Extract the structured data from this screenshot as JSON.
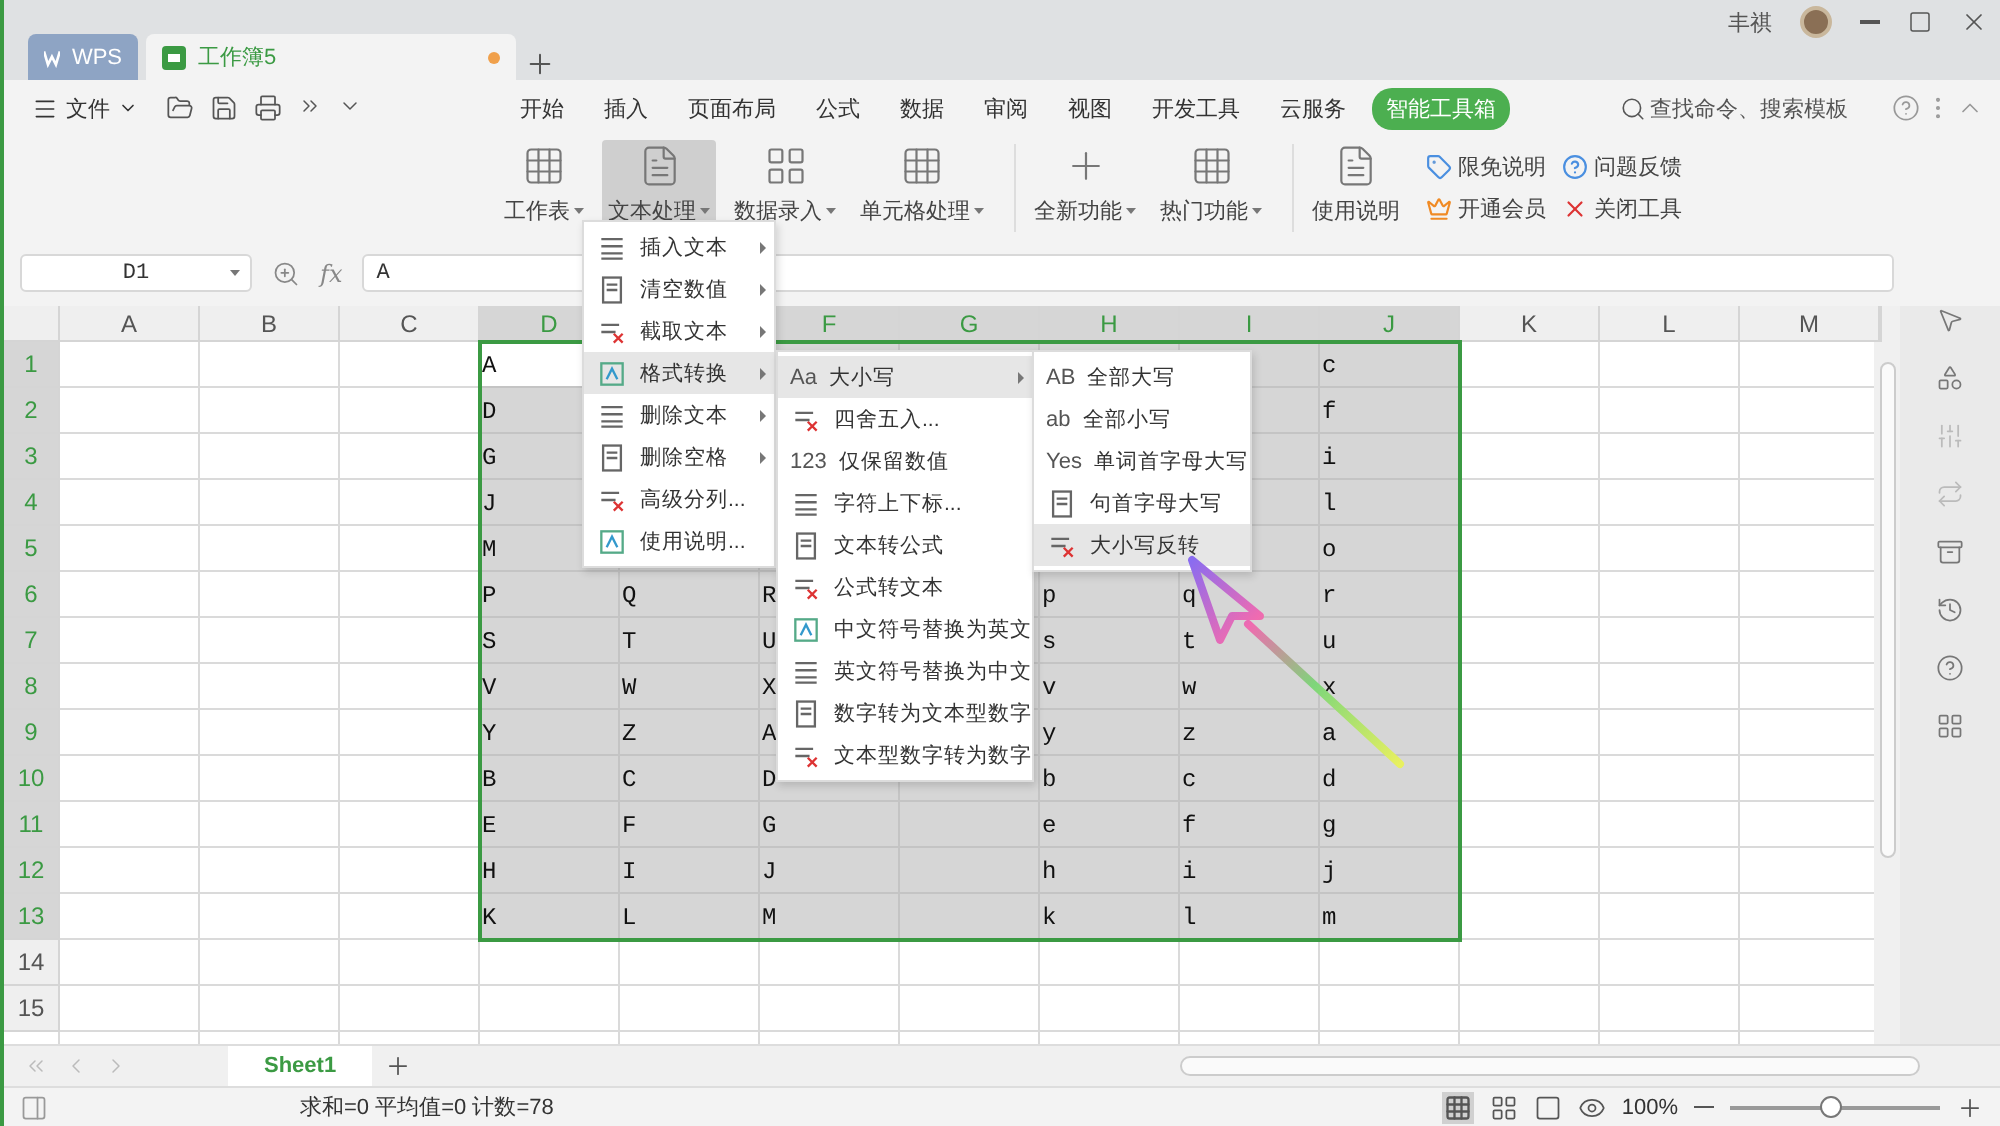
{
  "title_bar": {
    "tabs": [
      {
        "label": "WPS",
        "kind": "home",
        "selected": false
      },
      {
        "label": "工作簿5",
        "kind": "doc",
        "selected": true,
        "unsaved": true
      }
    ],
    "user": "丰祺"
  },
  "quick_bar": {
    "menu": "文件"
  },
  "ribbon_tabs": [
    {
      "label": "开始",
      "selected": false
    },
    {
      "label": "插入",
      "selected": false
    },
    {
      "label": "页面布局",
      "selected": false
    },
    {
      "label": "公式",
      "selected": false
    },
    {
      "label": "数据",
      "selected": false
    },
    {
      "label": "审阅",
      "selected": false
    },
    {
      "label": "视图",
      "selected": false
    },
    {
      "label": "开发工具",
      "selected": false
    },
    {
      "label": "云服务",
      "selected": false
    },
    {
      "label": "智能工具箱",
      "selected": true
    }
  ],
  "search": {
    "placeholder": "查找命令、搜索模板"
  },
  "ribbon": {
    "groups": [
      [
        {
          "label": "工作表",
          "dropdown": true,
          "pressed": false
        },
        {
          "label": "文本处理",
          "dropdown": true,
          "pressed": true
        },
        {
          "label": "数据录入",
          "dropdown": true,
          "pressed": false
        },
        {
          "label": "单元格处理",
          "dropdown": true,
          "pressed": false
        }
      ],
      [
        {
          "label": "全新功能",
          "dropdown": true,
          "pressed": false
        },
        {
          "label": "热门功能",
          "dropdown": true,
          "pressed": false
        }
      ],
      [
        {
          "label": "使用说明",
          "dropdown": false,
          "pressed": false
        }
      ]
    ],
    "small_buttons": [
      {
        "label": "限免说明"
      },
      {
        "label": "问题反馈"
      },
      {
        "label": "开通会员"
      },
      {
        "label": "关闭工具"
      }
    ]
  },
  "formula_bar": {
    "name_box": "D1",
    "fx": "fx",
    "value": "A"
  },
  "sheet": {
    "columns": [
      {
        "label": "A",
        "selected": false
      },
      {
        "label": "B",
        "selected": false
      },
      {
        "label": "C",
        "selected": false
      },
      {
        "label": "D",
        "selected": true
      },
      {
        "selected": true
      },
      {
        "label": "F",
        "selected": true
      },
      {
        "label": "G",
        "selected": true
      },
      {
        "label": "H",
        "selected": true
      },
      {
        "label": "I",
        "selected": true
      },
      {
        "label": "J",
        "selected": true
      },
      {
        "label": "K",
        "selected": false
      },
      {
        "label": "L",
        "selected": false
      },
      {
        "label": "M",
        "selected": false
      }
    ],
    "rows": [
      {
        "label": "1",
        "selected": true,
        "cells": [
          null,
          null,
          null,
          {
            "text": "A",
            "active": true
          },
          null,
          null,
          null,
          null,
          null,
          {
            "text": "c",
            "active": false
          },
          null,
          null,
          null
        ]
      },
      {
        "label": "2",
        "selected": true,
        "cells": [
          null,
          null,
          null,
          {
            "text": "D",
            "active": false
          },
          null,
          null,
          null,
          null,
          null,
          {
            "text": "f",
            "active": false
          },
          null,
          null,
          null
        ]
      },
      {
        "label": "3",
        "selected": true,
        "cells": [
          null,
          null,
          null,
          {
            "text": "G",
            "active": false
          },
          null,
          null,
          null,
          null,
          null,
          {
            "text": "i",
            "active": false
          },
          null,
          null,
          null
        ]
      },
      {
        "label": "4",
        "selected": true,
        "cells": [
          null,
          null,
          null,
          {
            "text": "J",
            "active": false
          },
          null,
          null,
          null,
          null,
          null,
          {
            "text": "l",
            "active": false
          },
          null,
          null,
          null
        ]
      },
      {
        "label": "5",
        "selected": true,
        "cells": [
          null,
          null,
          null,
          {
            "text": "M",
            "active": false
          },
          null,
          null,
          null,
          null,
          null,
          {
            "text": "o",
            "active": false
          },
          null,
          null,
          null
        ]
      },
      {
        "label": "6",
        "selected": true,
        "cells": [
          null,
          null,
          null,
          {
            "text": "P",
            "active": false
          },
          {
            "text": "Q",
            "active": false
          },
          {
            "text": "R",
            "active": false
          },
          null,
          {
            "text": "p",
            "active": false
          },
          {
            "text": "q",
            "active": false
          },
          {
            "text": "r",
            "active": false
          },
          null,
          null,
          null
        ]
      },
      {
        "label": "7",
        "selected": true,
        "cells": [
          null,
          null,
          null,
          {
            "text": "S",
            "active": false
          },
          {
            "text": "T",
            "active": false
          },
          {
            "text": "U",
            "active": false
          },
          null,
          {
            "text": "s",
            "active": false
          },
          {
            "text": "t",
            "active": false
          },
          {
            "text": "u",
            "active": false
          },
          null,
          null,
          null
        ]
      },
      {
        "label": "8",
        "selected": true,
        "cells": [
          null,
          null,
          null,
          {
            "text": "V",
            "active": false
          },
          {
            "text": "W",
            "active": false
          },
          {
            "text": "X",
            "active": false
          },
          null,
          {
            "text": "v",
            "active": false
          },
          {
            "text": "w",
            "active": false
          },
          {
            "text": "x",
            "active": false
          },
          null,
          null,
          null
        ]
      },
      {
        "label": "9",
        "selected": true,
        "cells": [
          null,
          null,
          null,
          {
            "text": "Y",
            "active": false
          },
          {
            "text": "Z",
            "active": false
          },
          {
            "text": "A",
            "active": false
          },
          null,
          {
            "text": "y",
            "active": false
          },
          {
            "text": "z",
            "active": false
          },
          {
            "text": "a",
            "active": false
          },
          null,
          null,
          null
        ]
      },
      {
        "label": "10",
        "selected": true,
        "cells": [
          null,
          null,
          null,
          {
            "text": "B",
            "active": false
          },
          {
            "text": "C",
            "active": false
          },
          {
            "text": "D",
            "active": false
          },
          null,
          {
            "text": "b",
            "active": false
          },
          {
            "text": "c",
            "active": false
          },
          {
            "text": "d",
            "active": false
          },
          null,
          null,
          null
        ]
      },
      {
        "label": "11",
        "selected": true,
        "cells": [
          null,
          null,
          null,
          {
            "text": "E",
            "active": false
          },
          {
            "text": "F",
            "active": false
          },
          {
            "text": "G",
            "active": false
          },
          null,
          {
            "text": "e",
            "active": false
          },
          {
            "text": "f",
            "active": false
          },
          {
            "text": "g",
            "active": false
          },
          null,
          null,
          null
        ]
      },
      {
        "label": "12",
        "selected": true,
        "cells": [
          null,
          null,
          null,
          {
            "text": "H",
            "active": false
          },
          {
            "text": "I",
            "active": false
          },
          {
            "text": "J",
            "active": false
          },
          null,
          {
            "text": "h",
            "active": false
          },
          {
            "text": "i",
            "active": false
          },
          {
            "text": "j",
            "active": false
          },
          null,
          null,
          null
        ]
      },
      {
        "label": "13",
        "selected": true,
        "cells": [
          null,
          null,
          null,
          {
            "text": "K",
            "active": false
          },
          {
            "text": "L",
            "active": false
          },
          {
            "text": "M",
            "active": false
          },
          null,
          {
            "text": "k",
            "active": false
          },
          {
            "text": "l",
            "active": false
          },
          {
            "text": "m",
            "active": false
          },
          null,
          null,
          null
        ]
      },
      {
        "label": "14",
        "selected": false,
        "cells": [
          null,
          null,
          null,
          null,
          null,
          null,
          null,
          null,
          null,
          null,
          null,
          null,
          null
        ]
      },
      {
        "label": "15",
        "selected": false,
        "cells": [
          null,
          null,
          null,
          null,
          null,
          null,
          null,
          null,
          null,
          null,
          null,
          null,
          null
        ]
      }
    ]
  },
  "menus": [
    {
      "items": [
        {
          "label": "插入文本",
          "submenu": true,
          "highlighted": false
        },
        {
          "label": "清空数值",
          "submenu": true,
          "highlighted": false
        },
        {
          "label": "截取文本",
          "submenu": true,
          "highlighted": false
        },
        {
          "label": "格式转换",
          "submenu": true,
          "highlighted": true
        },
        {
          "label": "删除文本",
          "submenu": true,
          "highlighted": false
        },
        {
          "label": "删除空格",
          "submenu": true,
          "highlighted": false
        },
        {
          "label": "高级分列...",
          "submenu": false,
          "highlighted": false
        },
        {
          "label": "使用说明...",
          "submenu": false,
          "highlighted": false
        }
      ]
    },
    {
      "items": [
        {
          "label": "大小写",
          "glyph": "Aa",
          "submenu": true,
          "highlighted": true
        },
        {
          "label": "四舍五入...",
          "submenu": false,
          "highlighted": false
        },
        {
          "label": "仅保留数值",
          "glyph": "123",
          "submenu": false,
          "highlighted": false
        },
        {
          "label": "字符上下标...",
          "submenu": false,
          "highlighted": false
        },
        {
          "label": "文本转公式",
          "submenu": false,
          "highlighted": false
        },
        {
          "label": "公式转文本",
          "submenu": false,
          "highlighted": false
        },
        {
          "label": "中文符号替换为英文",
          "submenu": false,
          "highlighted": false
        },
        {
          "label": "英文符号替换为中文",
          "submenu": false,
          "highlighted": false
        },
        {
          "label": "数字转为文本型数字",
          "submenu": false,
          "highlighted": false
        },
        {
          "label": "文本型数字转为数字",
          "submenu": false,
          "highlighted": false
        }
      ]
    },
    {
      "items": [
        {
          "label": "全部大写",
          "glyph": "AB",
          "submenu": false,
          "highlighted": false
        },
        {
          "label": "全部小写",
          "glyph": "ab",
          "submenu": false,
          "highlighted": false
        },
        {
          "label": "单词首字母大写",
          "glyph": "Yes",
          "submenu": false,
          "highlighted": false
        },
        {
          "label": "句首字母大写",
          "submenu": false,
          "highlighted": false
        },
        {
          "label": "大小写反转",
          "submenu": false,
          "highlighted": true
        }
      ]
    }
  ],
  "sheet_tabs": [
    {
      "label": "Sheet1",
      "selected": true
    }
  ],
  "status_bar": {
    "summary": "求和=0 平均值=0 计数=78",
    "zoom": "100%",
    "zoom_slider": {
      "level": 0.48
    }
  }
}
